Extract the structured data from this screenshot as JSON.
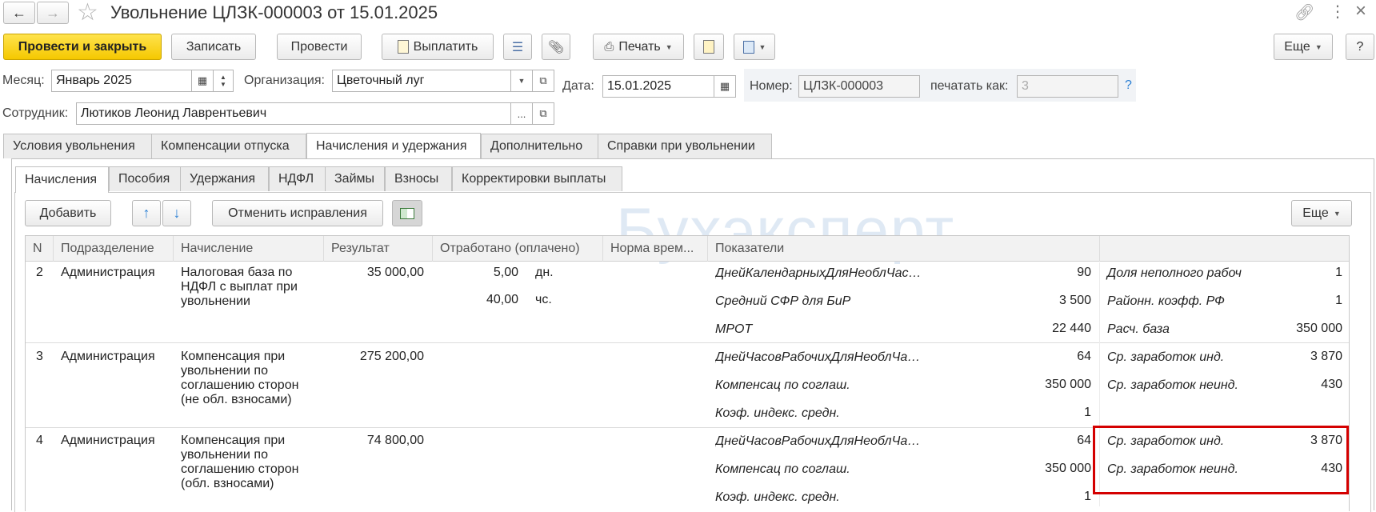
{
  "window": {
    "title": "Увольнение ЦЛЗК-000003 от 15.01.2025"
  },
  "toolbar": {
    "post_close": "Провести и закрыть",
    "save": "Записать",
    "post": "Провести",
    "pay": "Выплатить",
    "print": "Печать",
    "more": "Еще",
    "help": "?"
  },
  "form": {
    "month_label": "Месяц:",
    "month_value": "Январь 2025",
    "org_label": "Организация:",
    "org_value": "Цветочный луг",
    "date_label": "Дата:",
    "date_value": "15.01.2025",
    "number_label": "Номер:",
    "number_value": "ЦЛЗК-000003",
    "print_as_label": "печатать как:",
    "print_as_value": "3",
    "print_as_help": "?",
    "employee_label": "Сотрудник:",
    "employee_value": "Лютиков Леонид Лаврентьевич",
    "dots": "..."
  },
  "tabs": [
    "Условия увольнения",
    "Компенсации отпуска",
    "Начисления и удержания",
    "Дополнительно",
    "Справки при увольнении"
  ],
  "subtabs": [
    "Начисления",
    "Пособия",
    "Удержания",
    "НДФЛ",
    "Займы",
    "Взносы",
    "Корректировки выплаты"
  ],
  "subtoolbar": {
    "add": "Добавить",
    "cancel_corrections": "Отменить исправления",
    "more": "Еще"
  },
  "table": {
    "headers": [
      "N",
      "Подразделение",
      "Начисление",
      "Результат",
      "Отработано (оплачено)",
      "Норма врем...",
      "Показатели",
      ""
    ],
    "rows": [
      {
        "n": "2",
        "dept": "Администрация",
        "accrual": "Налоговая база по НДФЛ с выплат при увольнении",
        "result": "35 000,00",
        "worked": [
          {
            "value": "5,00",
            "unit": "дн."
          },
          {
            "value": "40,00",
            "unit": "чс."
          }
        ],
        "indicators": [
          {
            "name": "ДнейКалендарныхДляНеобл­Час…",
            "value": "90",
            "name2": "Доля неполного рабоч",
            "value2": "1"
          },
          {
            "name": "Средний СФР для БиР",
            "value": "3 500",
            "name2": "Районн. коэфф. РФ",
            "value2": "1"
          },
          {
            "name": "МРОТ",
            "value": "22 440",
            "name2": "Расч. база",
            "value2": "350 000"
          }
        ]
      },
      {
        "n": "3",
        "dept": "Администрация",
        "accrual": "Компенсация при увольнении по соглашению сторон (не обл. взносами)",
        "result": "275 200,00",
        "worked": [],
        "indicators": [
          {
            "name": "ДнейЧасовРабочихДляНеоблЧа…",
            "value": "64",
            "name2": "Ср. заработок инд.",
            "value2": "3 870"
          },
          {
            "name": "Компенсац по соглаш.",
            "value": "350 000",
            "name2": "Ср. заработок неинд.",
            "value2": "430"
          },
          {
            "name": "Коэф. индекс. средн.",
            "value": "1",
            "name2": "",
            "value2": ""
          }
        ]
      },
      {
        "n": "4",
        "dept": "Администрация",
        "accrual": "Компенсация при увольнении по соглашению сторон (обл. взносами)",
        "result": "74 800,00",
        "worked": [],
        "indicators": [
          {
            "name": "ДнейЧасовРабочихДляНеоблЧа…",
            "value": "64",
            "name2": "Ср. заработок инд.",
            "value2": "3 870"
          },
          {
            "name": "Компенсац по соглаш.",
            "value": "350 000",
            "name2": "Ср. заработок неинд.",
            "value2": "430"
          },
          {
            "name": "Коэф. индекс. средн.",
            "value": "1",
            "name2": "",
            "value2": ""
          }
        ]
      }
    ]
  },
  "watermark": "Бухэксперт",
  "colors": {
    "primary": "#f5c800",
    "highlight_border": "#d40000",
    "arrow_blue": "#2a7fd4"
  }
}
